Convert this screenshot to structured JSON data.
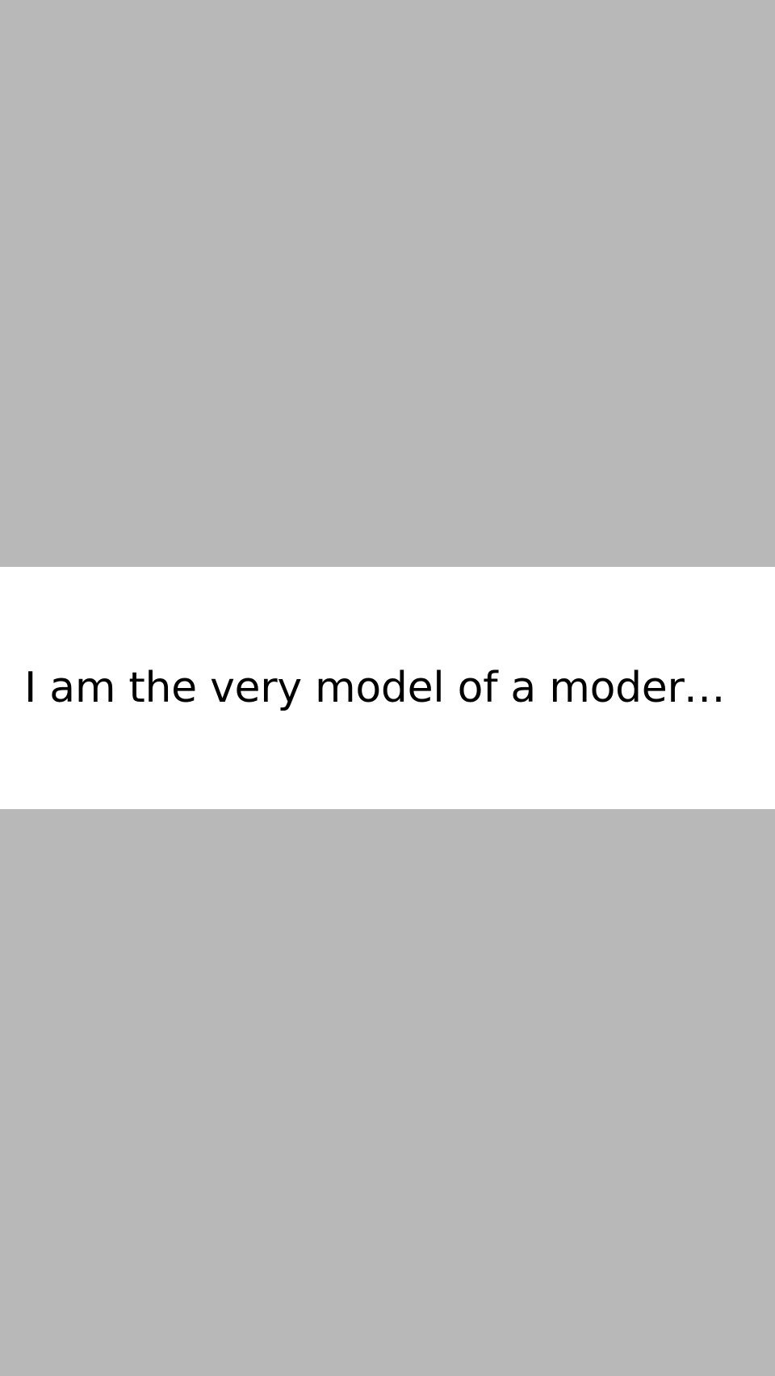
{
  "colors": {
    "background": "#b8b8b8",
    "row_background": "#ffffff",
    "text": "#000000"
  },
  "row": {
    "text": "I am the very model of a modern ma…"
  }
}
